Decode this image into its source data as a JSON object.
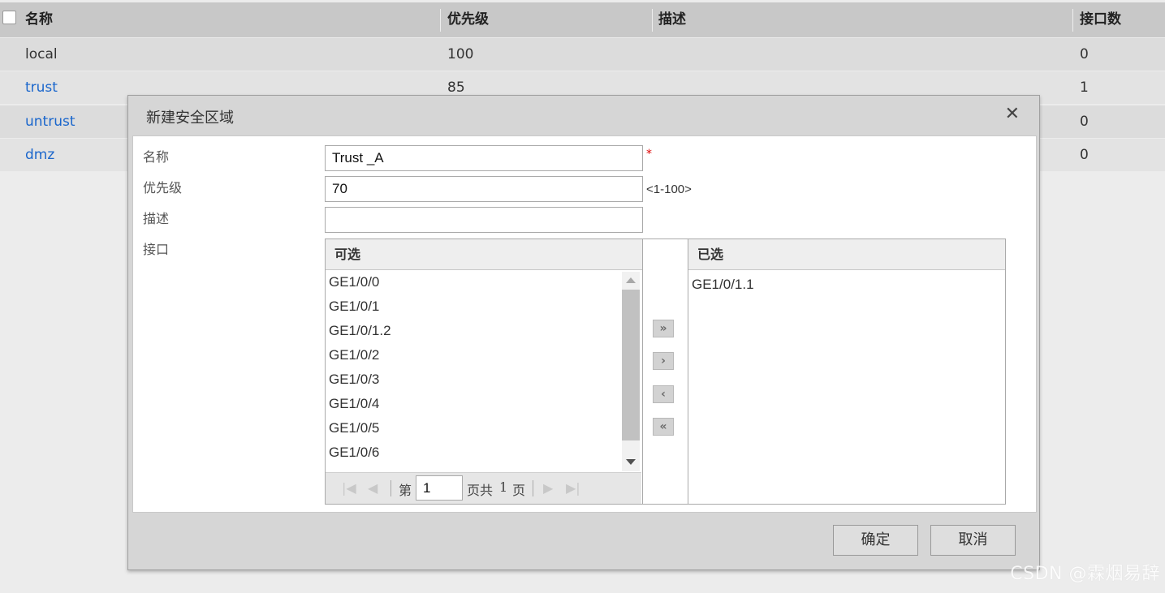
{
  "table": {
    "headers": [
      "名称",
      "优先级",
      "描述",
      "接口数"
    ],
    "rows": [
      {
        "name": "local",
        "priority": "100",
        "desc": "",
        "count": "0"
      },
      {
        "name": "trust",
        "priority": "85",
        "desc": "",
        "count": "1"
      },
      {
        "name": "untrust",
        "priority": "",
        "desc": "",
        "count": "0"
      },
      {
        "name": "dmz",
        "priority": "",
        "desc": "",
        "count": "0"
      }
    ]
  },
  "dialog": {
    "title": "新建安全区域",
    "close_icon": "close-icon",
    "fields": {
      "name_label": "名称",
      "name_value": "Trust _A",
      "required_mark": "*",
      "priority_label": "优先级",
      "priority_value": "70",
      "priority_hint": "<1-100>",
      "desc_label": "描述",
      "desc_value": "",
      "iface_label": "接口"
    },
    "available": {
      "header": "可选",
      "items": [
        "GE1/0/0",
        "GE1/0/1",
        "GE1/0/1.2",
        "GE1/0/2",
        "GE1/0/3",
        "GE1/0/4",
        "GE1/0/5",
        "GE1/0/6"
      ]
    },
    "selected": {
      "header": "已选",
      "items": [
        "GE1/0/1.1"
      ]
    },
    "pager": {
      "prefix": "第",
      "page": "1",
      "suffix_total": "页共",
      "total": "1",
      "suffix": "页"
    },
    "move_buttons": [
      "»",
      "›",
      "‹",
      "«"
    ],
    "ok_label": "确定",
    "cancel_label": "取消"
  },
  "watermark": "CSDN @霖烟易辞",
  "colors": {
    "link": "#1a66cc",
    "required": "#dd0000"
  }
}
